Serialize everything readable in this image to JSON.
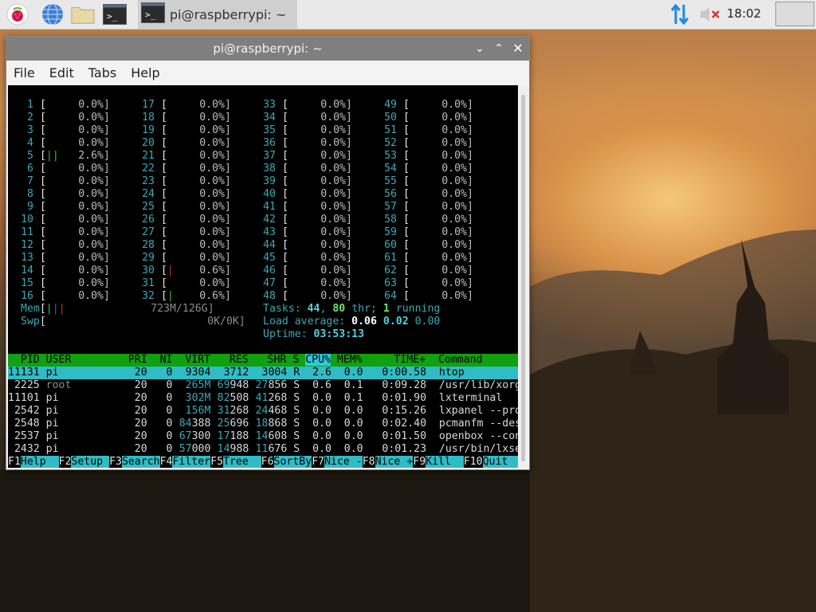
{
  "taskbar": {
    "icons": [
      "raspberry-menu-icon",
      "web-browser-icon",
      "file-manager-icon",
      "terminal-launcher-icon"
    ],
    "task_title": "pi@raspberrypi: ~",
    "clock": "18:02",
    "tray": [
      "network-arrows-icon",
      "volume-muted-icon"
    ],
    "colors": {
      "bar": "#e9e9e9",
      "active_task": "#cfcfcf",
      "network": "#1e88e5"
    }
  },
  "window": {
    "title": "pi@raspberrypi: ~",
    "controls": [
      "minimize",
      "maximize",
      "close"
    ],
    "menu": [
      "File",
      "Edit",
      "Tabs",
      "Help"
    ]
  },
  "htop": {
    "cpus": [
      {
        "n": "1",
        "bar": "",
        "pct": "0.0%]"
      },
      {
        "n": "2",
        "bar": "",
        "pct": "0.0%]"
      },
      {
        "n": "3",
        "bar": "",
        "pct": "0.0%]"
      },
      {
        "n": "4",
        "bar": "",
        "pct": "0.0%]"
      },
      {
        "n": "5",
        "bar": "||",
        "pct": "2.6%]"
      },
      {
        "n": "6",
        "bar": "",
        "pct": "0.0%]"
      },
      {
        "n": "7",
        "bar": "",
        "pct": "0.0%]"
      },
      {
        "n": "8",
        "bar": "",
        "pct": "0.0%]"
      },
      {
        "n": "9",
        "bar": "",
        "pct": "0.0%]"
      },
      {
        "n": "10",
        "bar": "",
        "pct": "0.0%]"
      },
      {
        "n": "11",
        "bar": "",
        "pct": "0.0%]"
      },
      {
        "n": "12",
        "bar": "",
        "pct": "0.0%]"
      },
      {
        "n": "13",
        "bar": "",
        "pct": "0.0%]"
      },
      {
        "n": "14",
        "bar": "",
        "pct": "0.0%]"
      },
      {
        "n": "15",
        "bar": "",
        "pct": "0.0%]"
      },
      {
        "n": "16",
        "bar": "",
        "pct": "0.0%]"
      },
      {
        "n": "17",
        "bar": "",
        "pct": "0.0%]"
      },
      {
        "n": "18",
        "bar": "",
        "pct": "0.0%]"
      },
      {
        "n": "19",
        "bar": "",
        "pct": "0.0%]"
      },
      {
        "n": "20",
        "bar": "",
        "pct": "0.0%]"
      },
      {
        "n": "21",
        "bar": "",
        "pct": "0.0%]"
      },
      {
        "n": "22",
        "bar": "",
        "pct": "0.0%]"
      },
      {
        "n": "23",
        "bar": "",
        "pct": "0.0%]"
      },
      {
        "n": "24",
        "bar": "",
        "pct": "0.0%]"
      },
      {
        "n": "25",
        "bar": "",
        "pct": "0.0%]"
      },
      {
        "n": "26",
        "bar": "",
        "pct": "0.0%]"
      },
      {
        "n": "27",
        "bar": "",
        "pct": "0.0%]"
      },
      {
        "n": "28",
        "bar": "",
        "pct": "0.0%]"
      },
      {
        "n": "29",
        "bar": "",
        "pct": "0.0%]"
      },
      {
        "n": "30",
        "bar": "|",
        "pct": "0.6%]"
      },
      {
        "n": "31",
        "bar": "",
        "pct": "0.0%]"
      },
      {
        "n": "32",
        "bar": "|",
        "pct": "0.6%]"
      },
      {
        "n": "33",
        "bar": "",
        "pct": "0.0%]"
      },
      {
        "n": "34",
        "bar": "",
        "pct": "0.0%]"
      },
      {
        "n": "35",
        "bar": "",
        "pct": "0.0%]"
      },
      {
        "n": "36",
        "bar": "",
        "pct": "0.0%]"
      },
      {
        "n": "37",
        "bar": "",
        "pct": "0.0%]"
      },
      {
        "n": "38",
        "bar": "",
        "pct": "0.0%]"
      },
      {
        "n": "39",
        "bar": "",
        "pct": "0.0%]"
      },
      {
        "n": "40",
        "bar": "",
        "pct": "0.0%]"
      },
      {
        "n": "41",
        "bar": "",
        "pct": "0.0%]"
      },
      {
        "n": "42",
        "bar": "",
        "pct": "0.0%]"
      },
      {
        "n": "43",
        "bar": "",
        "pct": "0.0%]"
      },
      {
        "n": "44",
        "bar": "",
        "pct": "0.0%]"
      },
      {
        "n": "45",
        "bar": "",
        "pct": "0.0%]"
      },
      {
        "n": "46",
        "bar": "",
        "pct": "0.0%]"
      },
      {
        "n": "47",
        "bar": "",
        "pct": "0.0%]"
      },
      {
        "n": "48",
        "bar": "",
        "pct": "0.0%]"
      },
      {
        "n": "49",
        "bar": "",
        "pct": "0.0%]"
      },
      {
        "n": "50",
        "bar": "",
        "pct": "0.0%]"
      },
      {
        "n": "51",
        "bar": "",
        "pct": "0.0%]"
      },
      {
        "n": "52",
        "bar": "",
        "pct": "0.0%]"
      },
      {
        "n": "53",
        "bar": "",
        "pct": "0.0%]"
      },
      {
        "n": "54",
        "bar": "",
        "pct": "0.0%]"
      },
      {
        "n": "55",
        "bar": "",
        "pct": "0.0%]"
      },
      {
        "n": "56",
        "bar": "",
        "pct": "0.0%]"
      },
      {
        "n": "57",
        "bar": "",
        "pct": "0.0%]"
      },
      {
        "n": "58",
        "bar": "",
        "pct": "0.0%]"
      },
      {
        "n": "59",
        "bar": "",
        "pct": "0.0%]"
      },
      {
        "n": "60",
        "bar": "",
        "pct": "0.0%]"
      },
      {
        "n": "61",
        "bar": "",
        "pct": "0.0%]"
      },
      {
        "n": "62",
        "bar": "",
        "pct": "0.0%]"
      },
      {
        "n": "63",
        "bar": "",
        "pct": "0.0%]"
      },
      {
        "n": "64",
        "bar": "",
        "pct": "0.0%]"
      }
    ],
    "mem": {
      "label": "Mem",
      "bar": "|||",
      "value": "723M/126G]"
    },
    "swp": {
      "label": "Swp",
      "bar": "",
      "value": "0K/0K]"
    },
    "tasks": {
      "label": "Tasks: ",
      "count": "44",
      "sep": ", ",
      "thr": "80",
      "thr_label": " thr; ",
      "running": "1",
      "running_label": " running"
    },
    "load": {
      "label": "Load average: ",
      "l1": "0.06",
      "l5": "0.02",
      "l15": "0.00"
    },
    "uptime": {
      "label": "Uptime: ",
      "value": "03:53:13"
    },
    "columns": {
      "pid": "  PID",
      "user": "USER",
      "pri": "PRI",
      "ni": "NI",
      "virt": "VIRT",
      "res": "RES",
      "shr": "SHR",
      "s": "S",
      "cpu": "CPU%",
      "mem": "MEM%",
      "time": "TIME+",
      "cmd": "Command"
    },
    "processes": [
      {
        "pid": "11131",
        "user": "pi",
        "pri": "20",
        "ni": "0",
        "virt": "9304",
        "res": "3712",
        "shr": "3004",
        "s": "R",
        "cpu": "2.6",
        "mem": "0.0",
        "time": "0:00.58",
        "cmd": "htop"
      },
      {
        "pid": "2225",
        "user": "root",
        "pri": "20",
        "ni": "0",
        "virt": "265M",
        "res": "69948",
        "shr": "27856",
        "s": "S",
        "cpu": "0.6",
        "mem": "0.1",
        "time": "0:09.28",
        "cmd": "/usr/lib/xorg/Xor"
      },
      {
        "pid": "11101",
        "user": "pi",
        "pri": "20",
        "ni": "0",
        "virt": "302M",
        "res": "82508",
        "shr": "41268",
        "s": "S",
        "cpu": "0.0",
        "mem": "0.1",
        "time": "0:01.90",
        "cmd": "lxterminal"
      },
      {
        "pid": "2542",
        "user": "pi",
        "pri": "20",
        "ni": "0",
        "virt": "156M",
        "res": "31268",
        "shr": "24468",
        "s": "S",
        "cpu": "0.0",
        "mem": "0.0",
        "time": "0:15.26",
        "cmd": "lxpanel --profile"
      },
      {
        "pid": "2548",
        "user": "pi",
        "pri": "20",
        "ni": "0",
        "virt": "84388",
        "res": "25696",
        "shr": "18868",
        "s": "S",
        "cpu": "0.0",
        "mem": "0.0",
        "time": "0:02.40",
        "cmd": "pcmanfm --desktop"
      },
      {
        "pid": "2537",
        "user": "pi",
        "pri": "20",
        "ni": "0",
        "virt": "67300",
        "res": "17188",
        "shr": "14608",
        "s": "S",
        "cpu": "0.0",
        "mem": "0.0",
        "time": "0:01.50",
        "cmd": "openbox --config-"
      },
      {
        "pid": "2432",
        "user": "pi",
        "pri": "20",
        "ni": "0",
        "virt": "57000",
        "res": "14988",
        "shr": "11676",
        "s": "S",
        "cpu": "0.0",
        "mem": "0.0",
        "time": "0:01.23",
        "cmd": "/usr/bin/lxsessio"
      }
    ],
    "fkeys": [
      {
        "key": "F1",
        "label": "Help  "
      },
      {
        "key": "F2",
        "label": "Setup "
      },
      {
        "key": "F3",
        "label": "Search"
      },
      {
        "key": "F4",
        "label": "Filter"
      },
      {
        "key": "F5",
        "label": "Tree  "
      },
      {
        "key": "F6",
        "label": "SortBy"
      },
      {
        "key": "F7",
        "label": "Nice -"
      },
      {
        "key": "F8",
        "label": "Nice +"
      },
      {
        "key": "F9",
        "label": "Kill  "
      },
      {
        "key": "F10",
        "label": "Quit  "
      }
    ]
  }
}
